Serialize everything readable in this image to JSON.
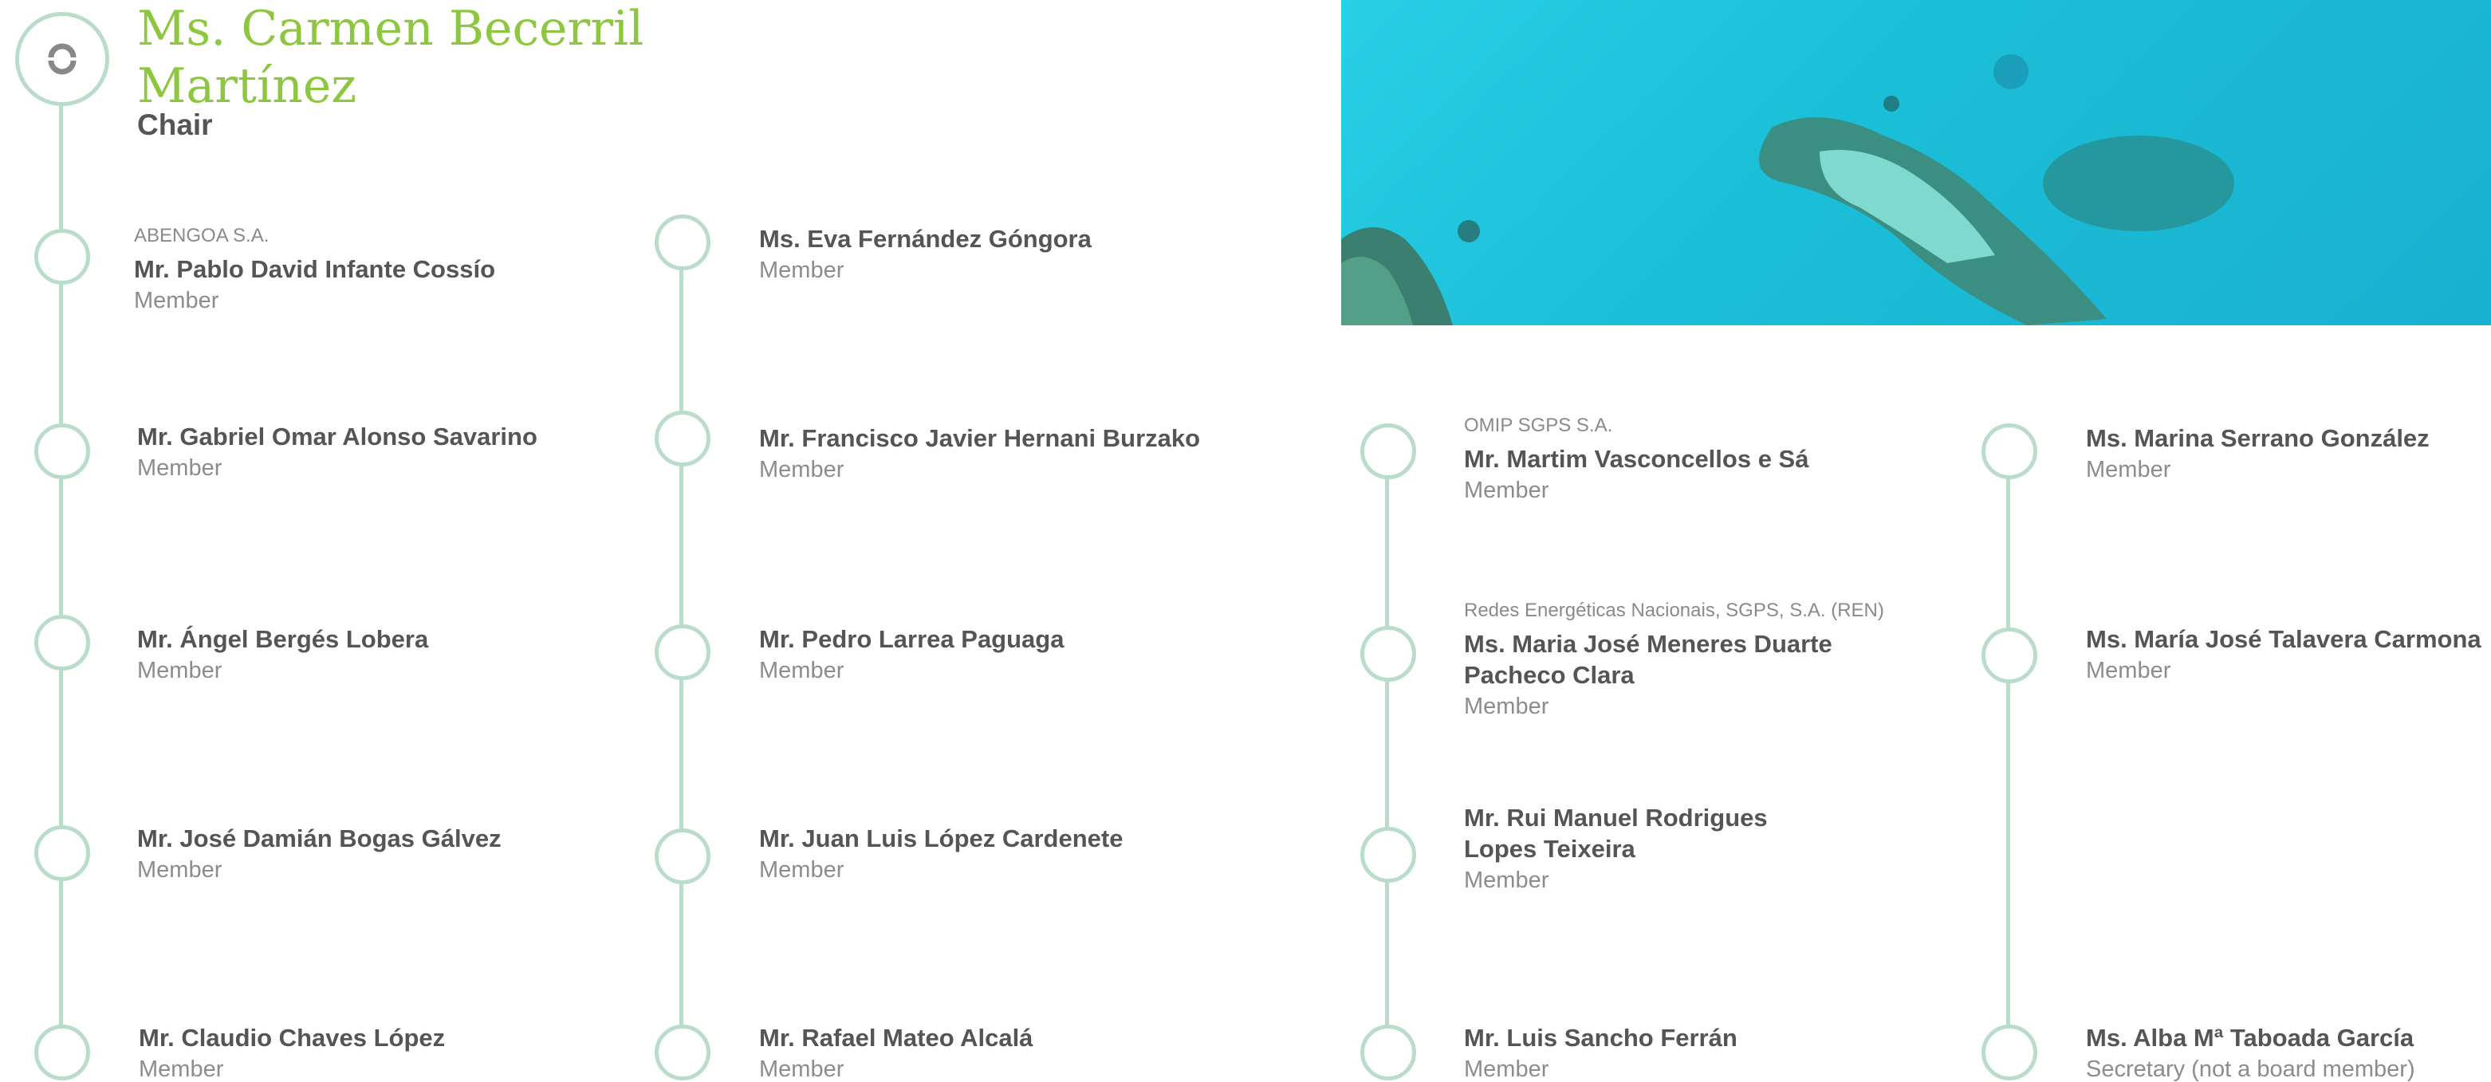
{
  "chair": {
    "name": "Ms. Carmen Becerril Martínez",
    "role": "Chair"
  },
  "members": [
    {
      "name": "Mr. Pablo David Infante Cossío",
      "role": "Member",
      "company": "ABENGOA S.A."
    },
    {
      "name": "Mr. Gabriel Omar Alonso Savarino",
      "role": "Member"
    },
    {
      "name": "Mr. Ángel Bergés Lobera",
      "role": "Member"
    },
    {
      "name": "Mr. José Damián Bogas Gálvez",
      "role": "Member"
    },
    {
      "name": "Mr. Claudio Chaves López",
      "role": "Member"
    },
    {
      "name": "Ms. Eva Fernández Góngora",
      "role": "Member"
    },
    {
      "name": "Mr. Francisco Javier Hernani Burzako",
      "role": "Member"
    },
    {
      "name": "Mr. Pedro Larrea Paguaga",
      "role": "Member"
    },
    {
      "name": "Mr. Juan Luis López Cardenete",
      "role": "Member"
    },
    {
      "name": "Mr. Rafael Mateo Alcalá",
      "role": "Member"
    },
    {
      "name": "Mr. Martim Vasconcellos e Sá",
      "role": "Member",
      "company": "OMIP SGPS S.A."
    },
    {
      "name_line1": "Ms. Maria José Meneres Duarte",
      "name_line2": "Pacheco Clara",
      "role": "Member",
      "company": "Redes Energéticas Nacionais, SGPS, S.A. (REN)"
    },
    {
      "name_line1": "Mr. Rui Manuel Rodrigues",
      "name_line2": "Lopes Teixeira",
      "role": "Member"
    },
    {
      "name": "Mr. Luis Sancho Ferrán",
      "role": "Member"
    },
    {
      "name": "Ms. Marina Serrano González",
      "role": "Member"
    },
    {
      "name": "Ms. María José Talavera Carmona",
      "role": "Member"
    },
    {
      "name": "Ms. Alba Mª Taboada García",
      "role": "Secretary (not a board member)"
    }
  ],
  "colors": {
    "accent_green": "#8dc63f",
    "timeline": "#b9dccb",
    "text_dark": "#555555",
    "text_light": "#8c8c8c"
  },
  "icons": {
    "chair_node": "refresh-arrows-icon"
  }
}
